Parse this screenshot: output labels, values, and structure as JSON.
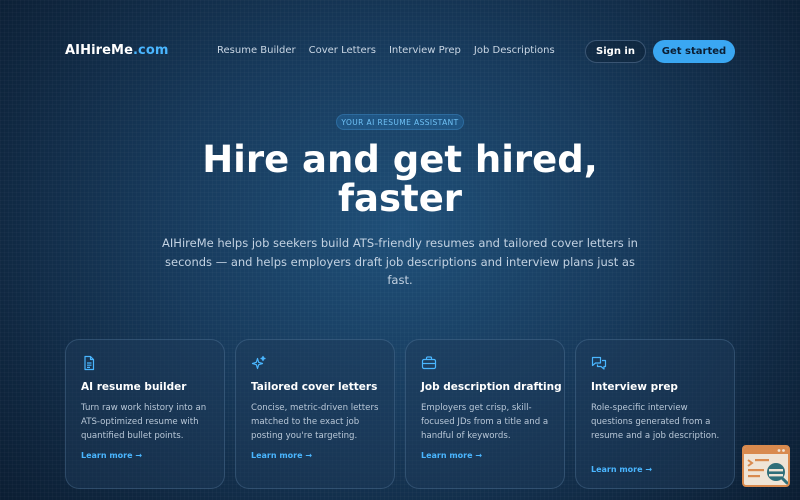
{
  "nav": {
    "logo_main": "AIHireMe",
    "logo_suffix": ".com",
    "links": [
      "Resume Builder",
      "Cover Letters",
      "Interview Prep",
      "Job Descriptions"
    ],
    "signin_label": "Sign in",
    "get_started_label": "Get started"
  },
  "hero": {
    "badge": "YOUR AI RESUME ASSISTANT",
    "title_line1": "Hire and get hired,",
    "title_line2": "faster",
    "subtitle": "AIHireMe helps job seekers build ATS-friendly resumes and tailored cover letters in seconds — and helps employers draft job descriptions and interview plans just as fast."
  },
  "cards": [
    {
      "icon": "document-icon",
      "title": "AI resume builder",
      "desc": "Turn raw work history into an ATS-optimized resume with quantified bullet points.",
      "link": "Learn more →"
    },
    {
      "icon": "sparkle-icon",
      "title": "Tailored cover letters",
      "desc": "Concise, metric-driven letters matched to the exact job posting you're targeting.",
      "link": "Learn more →"
    },
    {
      "icon": "briefcase-icon",
      "title": "Job description drafting",
      "desc": "Employers get crisp, skill-focused JDs from a title and a handful of keywords.",
      "link": "Learn more →"
    },
    {
      "icon": "chat-bubbles-icon",
      "title": "Interview prep",
      "desc": "Role-specific interview questions generated from a resume and a job description.",
      "link": "Learn more →"
    }
  ],
  "colors": {
    "accent": "#4ab6ff",
    "primary_button": "#3aa7f2",
    "background": "#173a5c"
  },
  "widget": {
    "icon": "feedback-widget-icon"
  }
}
